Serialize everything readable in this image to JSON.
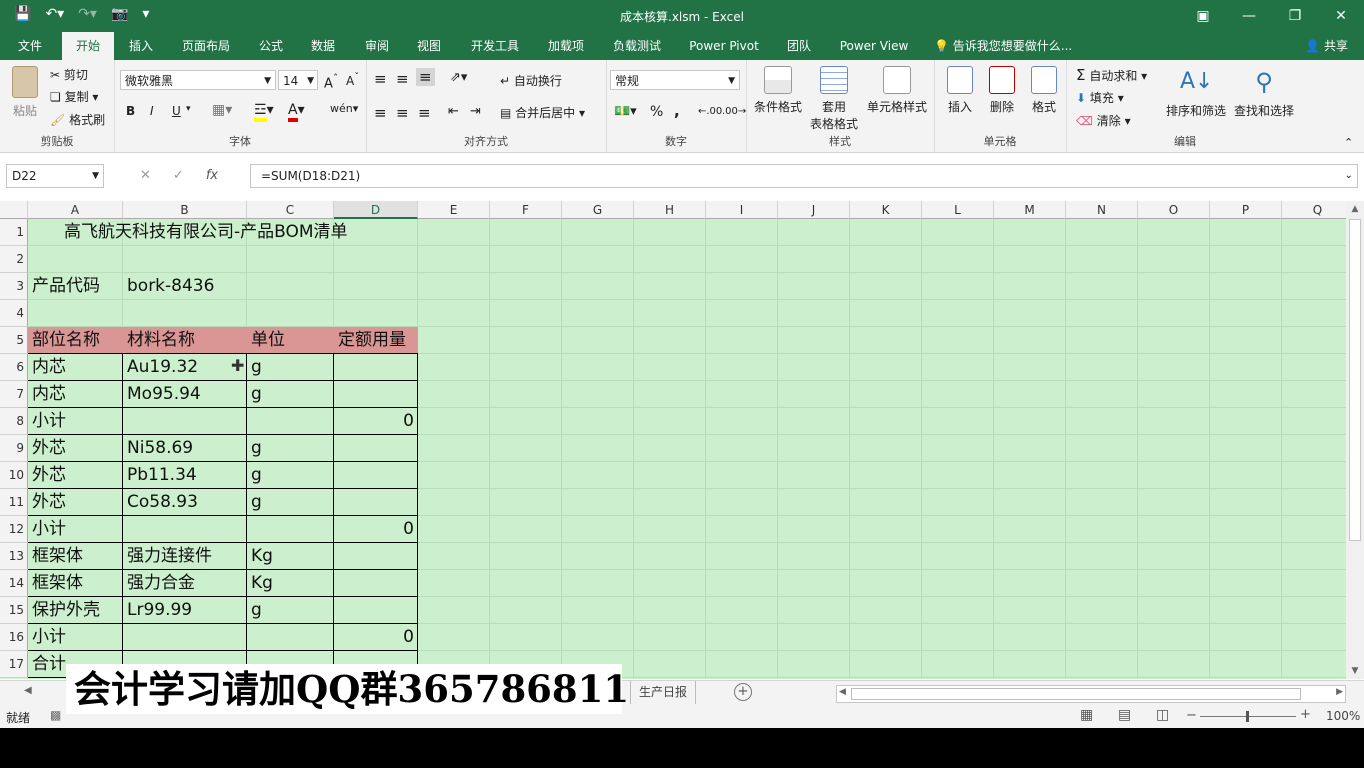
{
  "window": {
    "title": "成本核算.xlsm - Excel",
    "qat_icons": [
      "save-icon",
      "undo-icon",
      "redo-icon",
      "camera-icon",
      "customize-icon"
    ]
  },
  "tabs": [
    "文件",
    "开始",
    "插入",
    "页面布局",
    "公式",
    "数据",
    "审阅",
    "视图",
    "开发工具",
    "加载项",
    "负载测试",
    "Power Pivot",
    "团队",
    "Power View"
  ],
  "active_tab": "开始",
  "tell_me": "告诉我您想要做什么...",
  "share": "共享",
  "ribbon": {
    "clipboard": {
      "paste": "粘贴",
      "cut": "剪切",
      "copy": "复制",
      "format_painter": "格式刷",
      "label": "剪贴板"
    },
    "font": {
      "name": "微软雅黑",
      "size": "14",
      "bold": "B",
      "italic": "I",
      "underline": "U",
      "label": "字体"
    },
    "alignment": {
      "wrap": "自动换行",
      "merge": "合并后居中",
      "label": "对齐方式"
    },
    "number": {
      "format": "常规",
      "percent": "%",
      "comma": ",",
      "label": "数字"
    },
    "styles": {
      "conditional": "条件格式",
      "table_format_1": "套用",
      "table_format_2": "表格格式",
      "cell_styles": "单元格样式",
      "label": "样式"
    },
    "cells": {
      "insert": "插入",
      "delete": "删除",
      "format": "格式",
      "label": "单元格"
    },
    "editing": {
      "autosum": "自动求和",
      "fill": "填充",
      "clear": "清除",
      "sort": "排序和筛选",
      "find": "查找和选择",
      "label": "编辑"
    }
  },
  "formula_bar": {
    "name_box": "D22",
    "formula": "=SUM(D18:D21)"
  },
  "columns": [
    "A",
    "B",
    "C",
    "D",
    "E",
    "F",
    "G",
    "H",
    "I",
    "J",
    "K",
    "L",
    "M",
    "N",
    "O",
    "P",
    "Q"
  ],
  "selected_column": "D",
  "rows": [
    "1",
    "2",
    "3",
    "4",
    "5",
    "6",
    "7",
    "8",
    "9",
    "10",
    "11",
    "12",
    "13",
    "14",
    "15",
    "16",
    "17"
  ],
  "sheet": {
    "title": "高飞航天科技有限公司-产品BOM清单",
    "product_code_label": "产品代码",
    "product_code": "bork-8436",
    "headers": [
      "部位名称",
      "材料名称",
      "单位",
      "定额用量"
    ],
    "table": [
      [
        "内芯",
        "Au19.32",
        "g",
        ""
      ],
      [
        "内芯",
        "Mo95.94",
        "g",
        ""
      ],
      [
        "小计",
        "",
        "",
        "0"
      ],
      [
        "外芯",
        "Ni58.69",
        "g",
        ""
      ],
      [
        "外芯",
        "Pb11.34",
        "g",
        ""
      ],
      [
        "外芯",
        "Co58.93",
        "g",
        ""
      ],
      [
        "小计",
        "",
        "",
        "0"
      ],
      [
        "框架体",
        "强力连接件",
        "Kg",
        ""
      ],
      [
        "框架体",
        "强力合金",
        "Kg",
        ""
      ],
      [
        "保护外壳",
        "Lr99.99",
        "g",
        ""
      ],
      [
        "小计",
        "",
        "",
        "0"
      ],
      [
        "合计",
        "",
        "",
        ""
      ]
    ]
  },
  "sheet_tabs": {
    "visible_tab": "生产日报"
  },
  "status": {
    "ready": "就绪",
    "zoom": "100%"
  },
  "watermark": "会计学习请加QQ群365786811",
  "colors": {
    "excel_green": "#217346",
    "sheet_bg": "#ccf0cd",
    "header_fill": "#da9694"
  }
}
